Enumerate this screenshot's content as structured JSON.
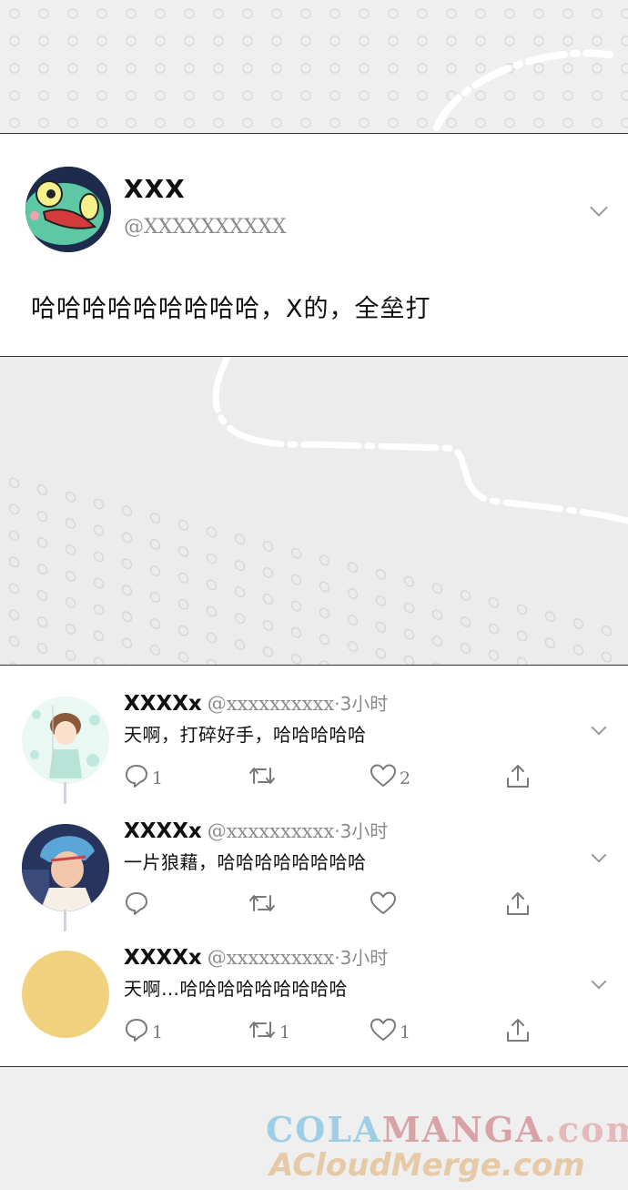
{
  "main_tweet": {
    "display_name": "XXX",
    "handle": "@XXXXXXXXXX",
    "text": "哈哈哈哈哈哈哈哈哈，X的，全垒打",
    "avatar_icon": "green-fish-mascot-avatar"
  },
  "replies": [
    {
      "display_name": "XXXXx",
      "handle": "@xxxxxxxxxx",
      "time": "·3小时",
      "text": "天啊，打碎好手，哈哈哈哈哈",
      "reply_count": "1",
      "retweet_count": "",
      "like_count": "2",
      "avatar_icon": "brown-haired-boy-avatar"
    },
    {
      "display_name": "XXXXx",
      "handle": "@xxxxxxxxxx",
      "time": "·3小时",
      "text": "一片狼藉，哈哈哈哈哈哈哈哈",
      "reply_count": "",
      "retweet_count": "",
      "like_count": "",
      "avatar_icon": "blue-haired-man-avatar"
    },
    {
      "display_name": "XXXXx",
      "handle": "@xxxxxxxxxx",
      "time": "·3小时",
      "text": "天啊…哈哈哈哈哈哈哈哈哈",
      "reply_count": "1",
      "retweet_count": "1",
      "like_count": "1",
      "avatar_icon": "yellow-circle-avatar"
    }
  ],
  "watermark": {
    "line1_a": "COLA",
    "line1_b": "MANGA",
    "line1_c": ".com",
    "line2": "ACloudMerge.com"
  },
  "colors": {
    "icon_gray": "#7a7a7a",
    "yellow_avatar": "#f0d27e",
    "background": "#eeeeee"
  }
}
